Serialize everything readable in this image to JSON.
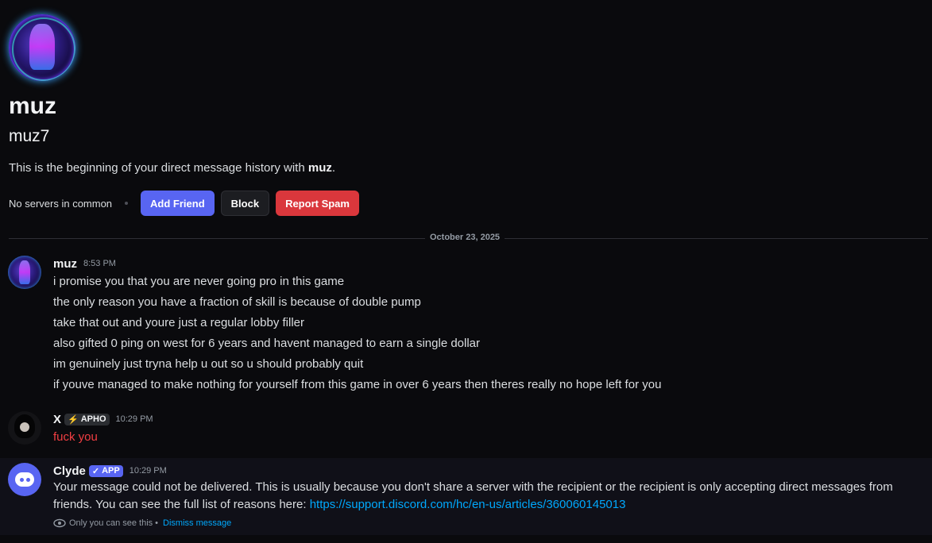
{
  "profile": {
    "display_name": "muz",
    "username": "muz7",
    "intro_prefix": "This is the beginning of your direct message history with ",
    "intro_name": "muz",
    "intro_suffix": ".",
    "no_servers": "No servers in common",
    "buttons": {
      "add_friend": "Add Friend",
      "block": "Block",
      "report_spam": "Report Spam"
    }
  },
  "divider_date": "October 23, 2025",
  "messages": [
    {
      "author": "muz",
      "time": "8:53 PM",
      "lines": [
        "i promise you that you are never going pro in this game",
        "the only reason you have a fraction of skill is because of double pump",
        "take that out and youre just a regular lobby filler",
        "also gifted 0 ping on west for 6 years and havent managed to earn a single dollar",
        "im genuinely just tryna help u out so u should probably quit",
        "if youve managed to make nothing for yourself from this game in over 6 years then theres really no hope left for you"
      ]
    },
    {
      "author": "X",
      "tag": "APHO",
      "time": "10:29 PM",
      "text": "fuck you",
      "text_color": "#f23f43"
    },
    {
      "author": "Clyde",
      "tag": "APP",
      "time": "10:29 PM",
      "line1": "Your message could not be delivered. This is usually because you don't share a server with the recipient or the recipient is only accepting direct messages from",
      "line2_prefix": "friends. You can see the full list of reasons here: ",
      "link": "https://support.discord.com/hc/en-us/articles/360060145013",
      "only_you": "Only you can see this",
      "separator": "•",
      "dismiss": "Dismiss message"
    }
  ],
  "icons": [
    "eye-icon",
    "check-icon",
    "lightning-icon",
    "dot-icon"
  ],
  "colors": {
    "background": "#0a0a0d",
    "primary_button": "#5865f2",
    "danger_button": "#da373c",
    "link": "#00a8fc"
  }
}
